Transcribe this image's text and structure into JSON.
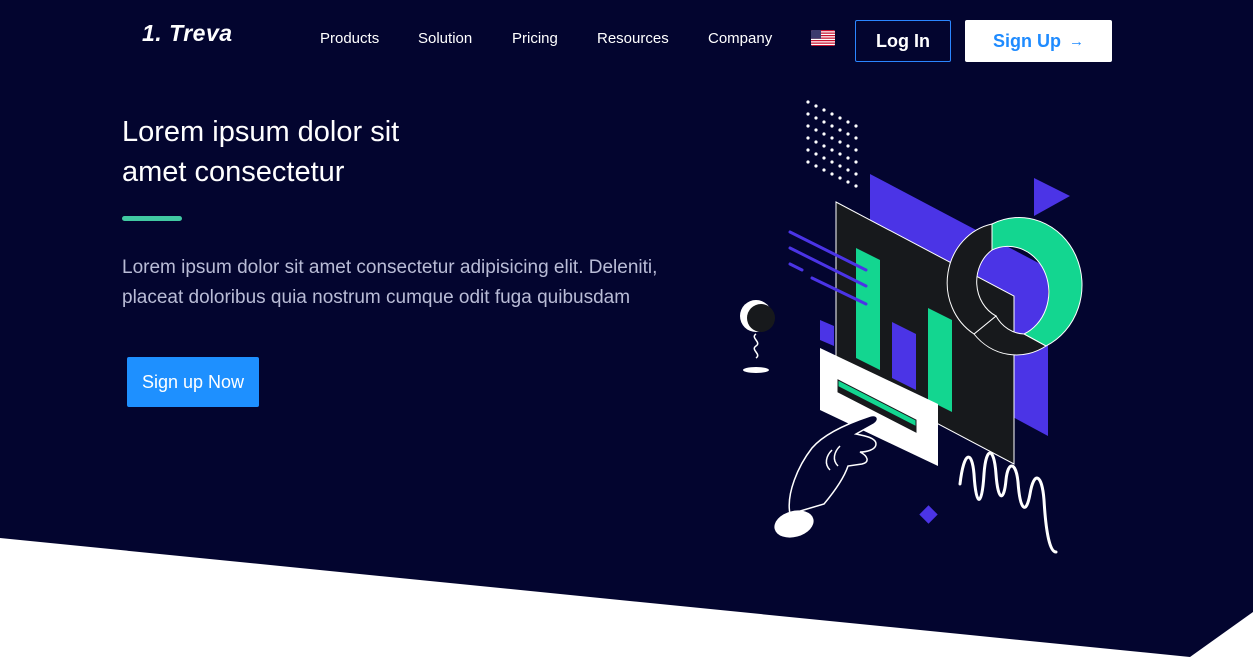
{
  "brand": {
    "logo_text": "1. Treva"
  },
  "nav": {
    "items": [
      {
        "label": "Products"
      },
      {
        "label": "Solution"
      },
      {
        "label": "Pricing"
      },
      {
        "label": "Resources"
      },
      {
        "label": "Company"
      }
    ],
    "language_icon": "us-flag-icon",
    "login_label": "Log In",
    "signup_label": "Sign Up",
    "signup_icon": "arrow-right-icon"
  },
  "hero": {
    "headline": "Lorem ipsum dolor sit amet consectetur",
    "description": "Lorem ipsum dolor sit amet consectetur adipisicing elit. Deleniti, placeat doloribus quia nostrum cumque odit fuga quibusdam",
    "cta_label": "Sign up Now"
  },
  "colors": {
    "background": "#03052f",
    "accent_green": "#41c9a2",
    "primary_blue": "#1e90ff",
    "illustration_purple": "#4b34e6",
    "illustration_green": "#13d690"
  }
}
